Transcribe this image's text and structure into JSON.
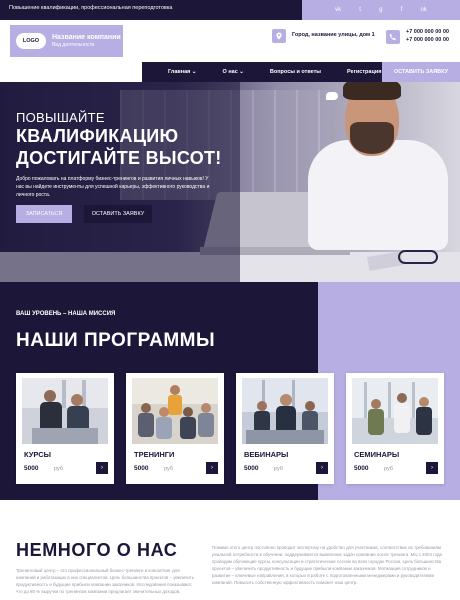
{
  "topbar": {
    "slogan": "Повышение квалификации, профессиональная переподготовка",
    "social_icons": [
      "vk-icon",
      "twitter-icon",
      "google-icon",
      "facebook-icon",
      "odnoklassniki-icon"
    ],
    "social_glyphs": [
      "vk",
      "t",
      "g",
      "f",
      "ok"
    ]
  },
  "header": {
    "logo_badge": "LOGO",
    "company_name": "Название компании",
    "company_activity": "Вид деятельности",
    "address": "Город, название улицы, дом 1",
    "phone1": "+7 000 000 00 00",
    "phone2": "+7 000 000 00 00"
  },
  "nav": {
    "items": [
      "Главная",
      "О нас",
      "Вопросы и ответы",
      "Регистрация"
    ],
    "cta": "ОСТАВИТЬ ЗАЯВКУ"
  },
  "hero": {
    "kicker": "ПОВЫШАЙТЕ",
    "title1": "КВАЛИФИКАЦИЮ",
    "title2": "ДОСТИГАЙТЕ ВЫСОТ!",
    "lead": "Добро пожаловать на платформу бизнес-тренингов и развития личных навыков! У нас вы найдете инструменты для успешной карьеры, эффективного руководства и личного роста.",
    "btn_primary": "ЗАПИСАТЬСЯ",
    "btn_secondary": "ОСТАВИТЬ ЗАЯВКУ"
  },
  "programs": {
    "mission": "ВАШ УРОВЕНЬ – НАША МИССИЯ",
    "heading": "НАШИ ПРОГРАММЫ",
    "cards": [
      {
        "title": "КУРСЫ",
        "price": "5000",
        "currency": "руб"
      },
      {
        "title": "ТРЕНИНГИ",
        "price": "5000",
        "currency": "руб"
      },
      {
        "title": "ВЕБИНАРЫ",
        "price": "5000",
        "currency": "руб"
      },
      {
        "title": "СЕМИНАРЫ",
        "price": "5000",
        "currency": "руб"
      }
    ],
    "arrow_glyph": "›"
  },
  "about": {
    "heading": "НЕМНОГО О НАС",
    "left_text": "Тренинговый центр – это профессиональный бизнес-тренинги и консалтинг для компаний и работающих в них специалистов. Цель большинства проектов – увеличить продуктивность и будущие прибыли компании заказчиков. Исследования показывают, что до 80 % выручки по тренингам компании предлагает значительных доходов.",
    "right_text": "Помимо этого центр постоянно проводит экспертизу на удобство для участников, соответствие их требованиям реальной потребности в обучении, поддерживается выявление задач компании после тренинга. Мы с 2004 года проводим обучающие курсы, консультации и стратегические сессии во всех городах России. Цель большинства проектов – увеличить продуктивность и будущие прибыли компании заказчиков. Мотивация сотрудников и развитие – ключевые направления, в которых в работе с подготовленными менеджерами и руководителями компаний. Повысить собственную эффективность поможет наш центр."
  }
}
